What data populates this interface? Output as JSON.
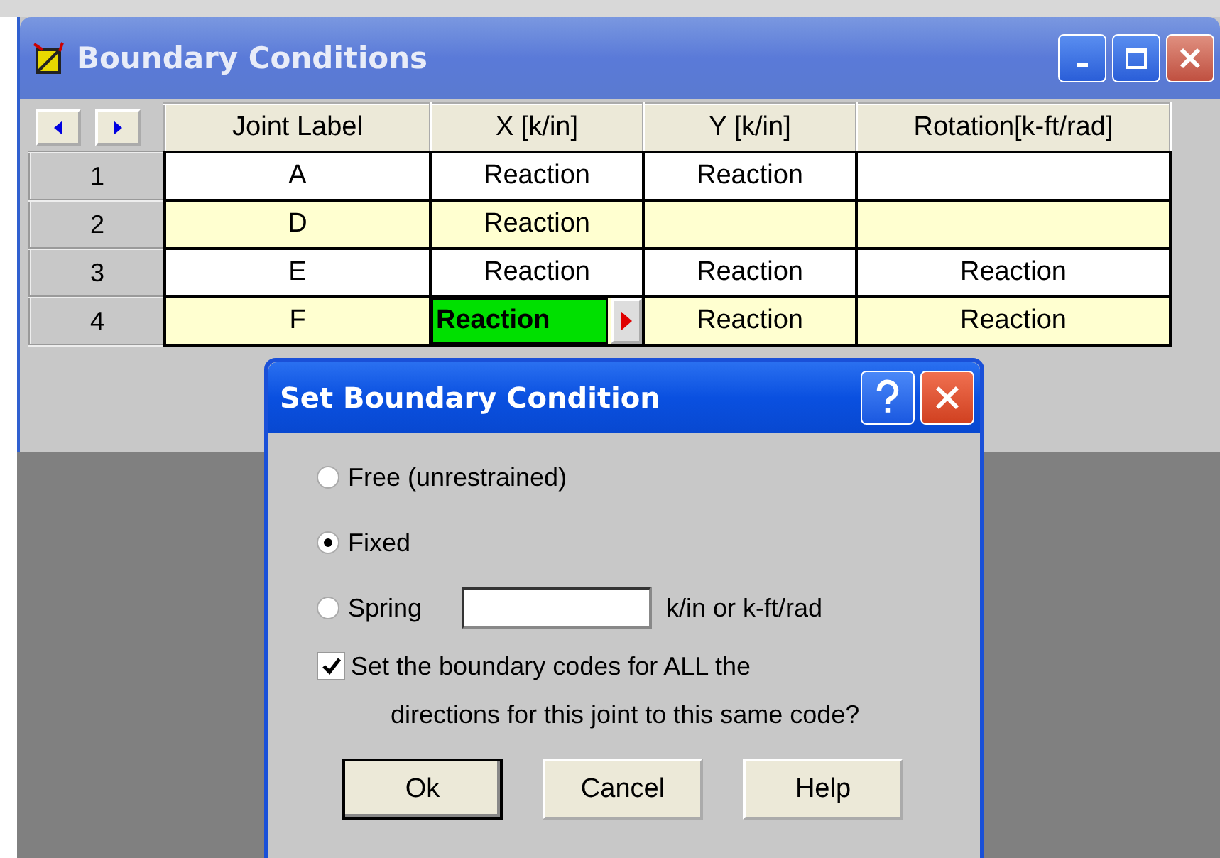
{
  "window": {
    "title": "Boundary Conditions"
  },
  "table": {
    "columns": [
      "Joint Label",
      "X [k/in]",
      "Y [k/in]",
      "Rotation[k-ft/rad]"
    ],
    "rows": [
      {
        "number": "1",
        "cells": [
          {
            "text": "A",
            "selected": false
          },
          {
            "text": "Reaction",
            "selected": false
          },
          {
            "text": "Reaction",
            "selected": false
          },
          {
            "selected": false
          }
        ]
      },
      {
        "number": "2",
        "cells": [
          {
            "text": "D",
            "selected": false
          },
          {
            "text": "Reaction",
            "selected": false
          },
          {
            "selected": false
          },
          {
            "selected": false
          }
        ]
      },
      {
        "number": "3",
        "cells": [
          {
            "text": "E",
            "selected": false
          },
          {
            "text": "Reaction",
            "selected": false
          },
          {
            "text": "Reaction",
            "selected": false
          },
          {
            "text": "Reaction",
            "selected": false
          }
        ]
      },
      {
        "number": "4",
        "cells": [
          {
            "text": "F",
            "selected": false
          },
          {
            "text": "Reaction",
            "selected": true
          },
          {
            "text": "Reaction",
            "selected": false
          },
          {
            "text": "Reaction",
            "selected": false
          }
        ]
      }
    ]
  },
  "dialog": {
    "title": "Set Boundary Condition",
    "options": [
      {
        "label": "Free (unrestrained)",
        "selected": false
      },
      {
        "label": "Fixed",
        "selected": true
      },
      {
        "label": "Spring",
        "selected": false
      }
    ],
    "spring_unit": "k/in or k-ft/rad",
    "apply_all": {
      "label": "Set the boundary codes for ALL the\ndirections for this joint to this same code?",
      "checked": true
    },
    "buttons": [
      {
        "label": "Ok",
        "default": true
      },
      {
        "label": "Cancel",
        "default": false
      },
      {
        "label": "Help",
        "default": false
      }
    ]
  }
}
